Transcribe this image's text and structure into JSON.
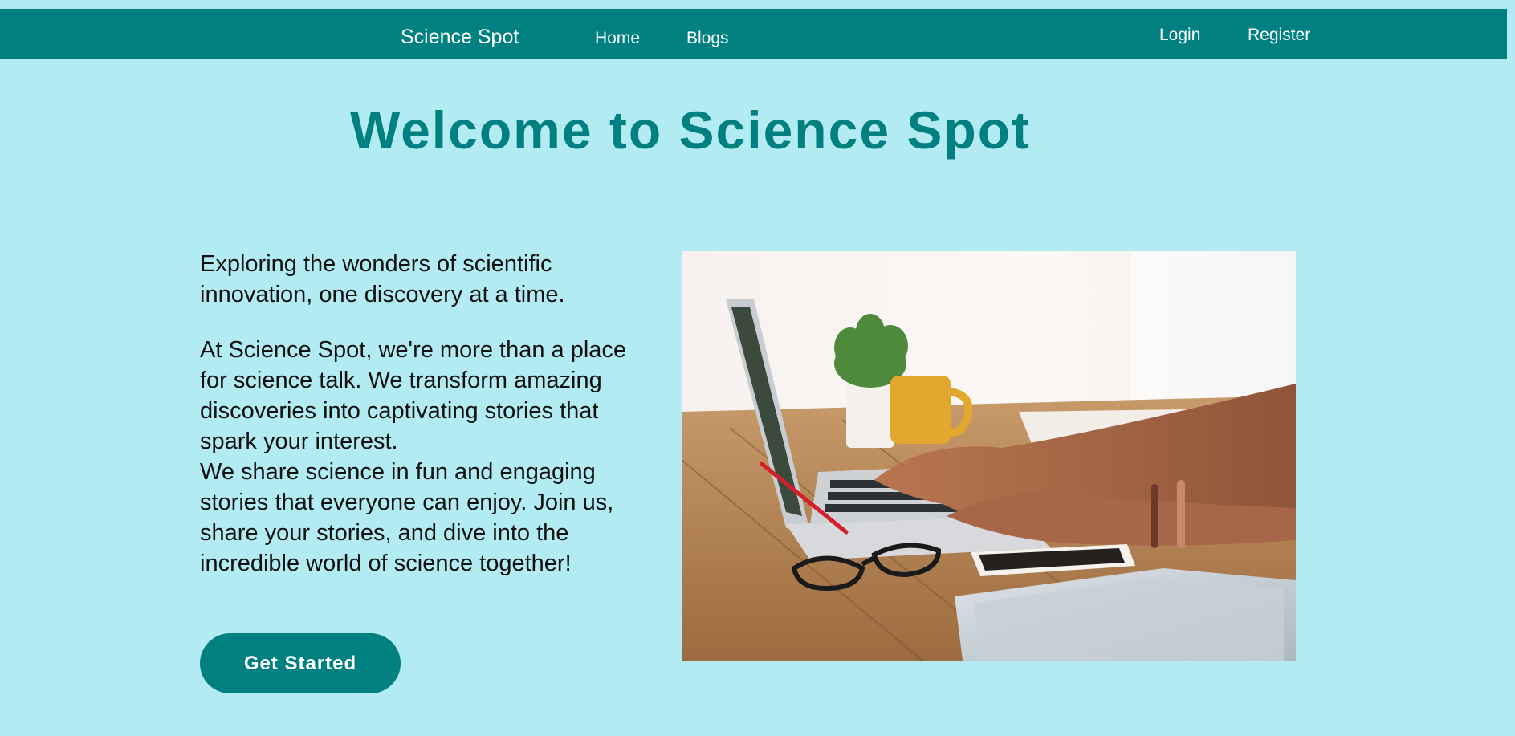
{
  "nav": {
    "brand": "Science Spot",
    "links": [
      "Home",
      "Blogs"
    ],
    "auth": [
      "Login",
      "Register"
    ]
  },
  "hero": {
    "title": "Welcome to Science Spot",
    "tagline": "Exploring the wonders of scientific innovation, one discovery at a time.",
    "paragraph_1": "At Science Spot, we're more than a place for science talk. We transform amazing discoveries into captivating stories that spark your interest.",
    "paragraph_2": "We share science in fun and engaging stories that everyone can enjoy. Join us, share your stories, and dive into the incredible world of science together!",
    "cta_label": "Get Started"
  },
  "colors": {
    "background": "#b2ebf2",
    "primary": "#008080",
    "text": "#111111",
    "on_primary": "#ffffff"
  }
}
